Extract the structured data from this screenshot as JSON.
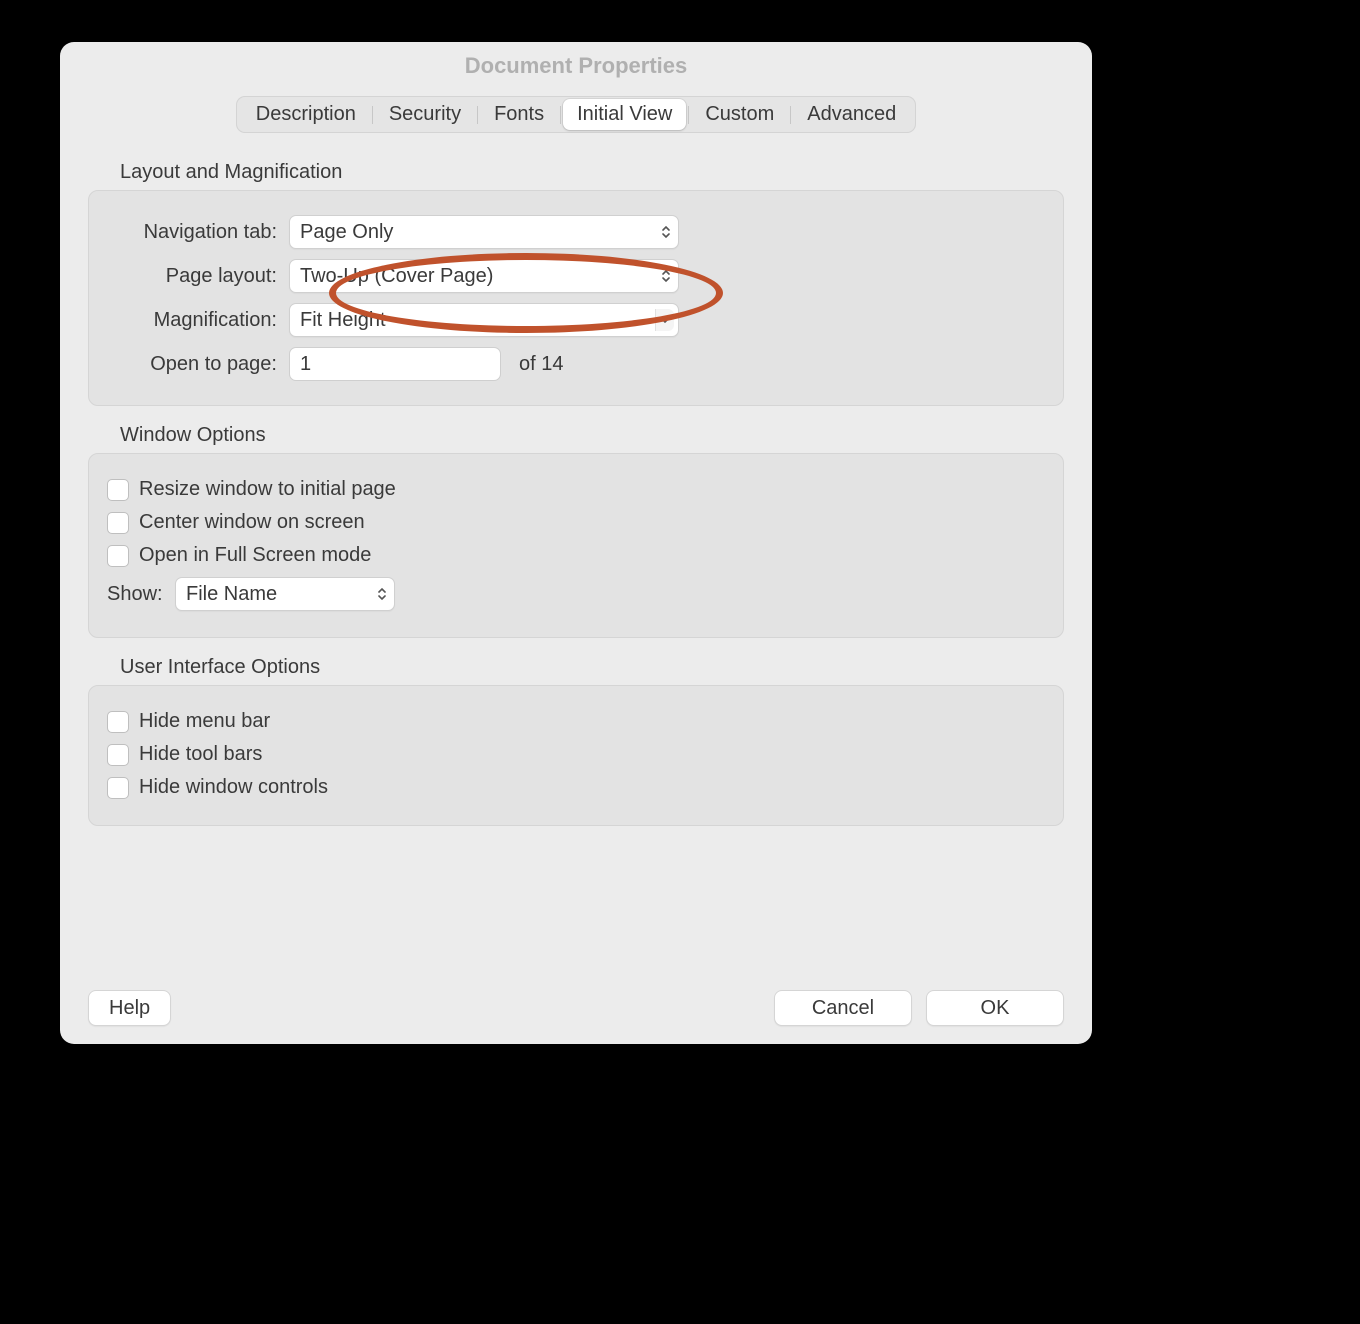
{
  "title": "Document Properties",
  "tabs": {
    "description": "Description",
    "security": "Security",
    "fonts": "Fonts",
    "initial_view": "Initial View",
    "custom": "Custom",
    "advanced": "Advanced"
  },
  "sections": {
    "layout": {
      "header": "Layout and Magnification",
      "nav_tab_label": "Navigation tab:",
      "nav_tab_value": "Page Only",
      "page_layout_label": "Page layout:",
      "page_layout_value": "Two-Up (Cover Page)",
      "magnification_label": "Magnification:",
      "magnification_value": "Fit Height",
      "open_to_page_label": "Open to page:",
      "open_to_page_value": "1",
      "of_pages": "of 14"
    },
    "window": {
      "header": "Window Options",
      "resize": "Resize window to initial page",
      "center": "Center window on screen",
      "fullscreen": "Open in Full Screen mode",
      "show_label": "Show:",
      "show_value": "File Name"
    },
    "ui": {
      "header": "User Interface Options",
      "hide_menu": "Hide menu bar",
      "hide_tool": "Hide tool bars",
      "hide_window": "Hide window controls"
    }
  },
  "buttons": {
    "help": "Help",
    "cancel": "Cancel",
    "ok": "OK"
  }
}
